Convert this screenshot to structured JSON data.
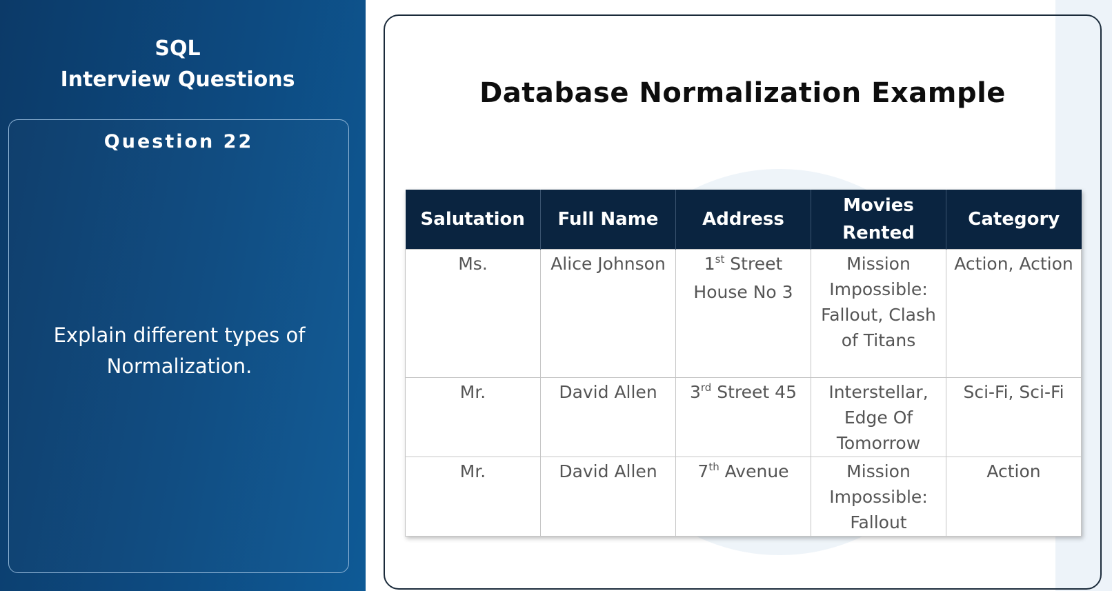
{
  "left_panel": {
    "brand_line1": "SQL",
    "brand_line2": "Interview Questions",
    "question_number": "Question 22",
    "question_text": "Explain different types of Normalization."
  },
  "slide": {
    "title": "Database Normalization Example"
  },
  "table": {
    "headers": [
      "Salutation",
      "Full Name",
      "Address",
      "Movies Rented",
      "Category"
    ],
    "rows": [
      {
        "salutation": "Ms.",
        "full_name": "Alice Johnson",
        "address_num": "1",
        "address_ord": "st",
        "address_rest": " Street House No 3",
        "movies": "Mission Impossible: Fallout, Clash of Titans",
        "category": "Action, Action"
      },
      {
        "salutation": "Mr.",
        "full_name": "David Allen",
        "address_num": "3",
        "address_ord": "rd",
        "address_rest": " Street 45",
        "movies": "Interstellar, Edge Of Tomorrow",
        "category": "Sci-Fi, Sci-Fi"
      },
      {
        "salutation": "Mr.",
        "full_name": "David Allen",
        "address_num": "7",
        "address_ord": "th",
        "address_rest": " Avenue",
        "movies": "Mission Impossible: Fallout",
        "category": "Action"
      }
    ]
  },
  "colors": {
    "left_panel_dark": "#0c3a68",
    "left_panel_light": "#0e5a96",
    "table_header_bg": "#0a2440",
    "table_text": "#555555"
  }
}
